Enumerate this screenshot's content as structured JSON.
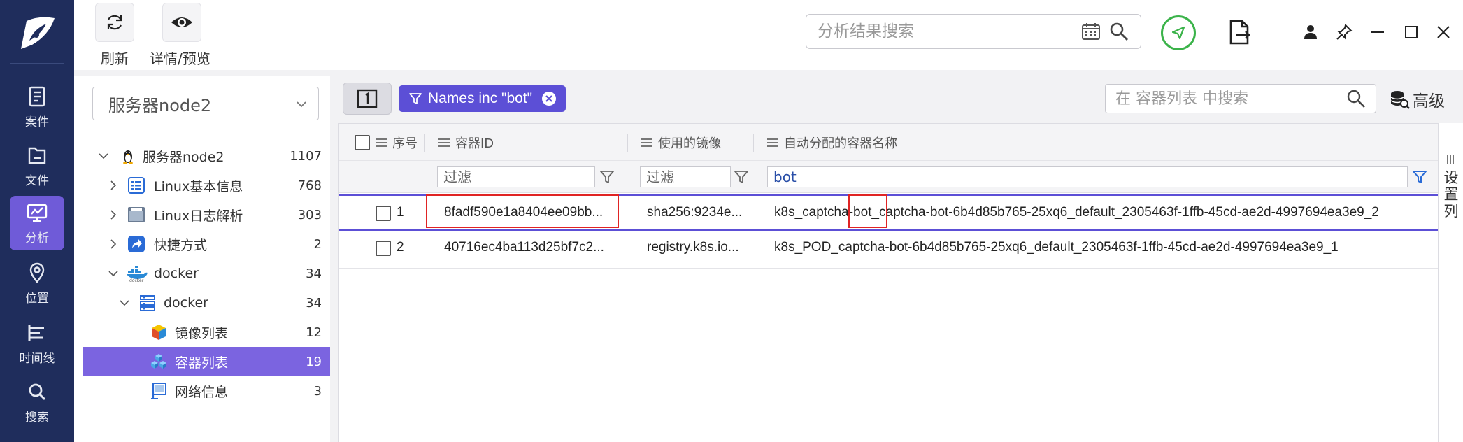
{
  "nav": {
    "items": [
      {
        "label": "案件",
        "icon": "case-icon"
      },
      {
        "label": "文件",
        "icon": "file-icon"
      },
      {
        "label": "分析",
        "icon": "analysis-icon",
        "active": true
      },
      {
        "label": "位置",
        "icon": "location-icon"
      },
      {
        "label": "时间线",
        "icon": "timeline-icon"
      },
      {
        "label": "搜索",
        "icon": "search-icon"
      }
    ]
  },
  "toolbar": {
    "refresh_label": "刷新",
    "details_label": "详情/预览",
    "search_placeholder": "分析结果搜索"
  },
  "tree": {
    "selector_value": "服务器node2",
    "rows": [
      {
        "label": "服务器node2",
        "count": "1107",
        "icon": "linux-penguin-icon",
        "expanded": true
      },
      {
        "label": "Linux基本信息",
        "count": "768",
        "icon": "list-icon",
        "expanded": false
      },
      {
        "label": "Linux日志解析",
        "count": "303",
        "icon": "log-icon",
        "expanded": false
      },
      {
        "label": "快捷方式",
        "count": "2",
        "icon": "shortcut-icon",
        "expanded": false
      },
      {
        "label": "docker",
        "count": "34",
        "icon": "docker-icon",
        "expanded": true
      },
      {
        "label": "docker",
        "count": "34",
        "icon": "server-icon",
        "expanded": true
      },
      {
        "label": "镜像列表",
        "count": "12",
        "icon": "image-cube-icon"
      },
      {
        "label": "容器列表",
        "count": "19",
        "icon": "containers-icon",
        "selected": true
      },
      {
        "label": "网络信息",
        "count": "3",
        "icon": "network-icon"
      }
    ]
  },
  "filterbar": {
    "chip_label": "Names inc \"bot\"",
    "search_placeholder": "在 容器列表 中搜索",
    "advanced_label": "高级"
  },
  "table": {
    "columns": [
      "序号",
      "容器ID",
      "使用的镜像",
      "自动分配的容器名称"
    ],
    "filters": {
      "id_placeholder": "过滤",
      "image_placeholder": "过滤",
      "name_value": "bot"
    },
    "rows": [
      {
        "index": "1",
        "id": "8fadf590e1a8404ee09bb...",
        "image": "sha256:9234e...",
        "name_prefix": "k8s_captcha",
        "name_match": "-bot_",
        "name_suffix": "captcha-bot-6b4d85b765-25xq6_default_2305463f-1ffb-45cd-ae2d-4997694ea3e9_2"
      },
      {
        "index": "2",
        "id": "40716ec4ba113d25bf7c2...",
        "image": "registry.k8s.io...",
        "name": "k8s_POD_captcha-bot-6b4d85b765-25xq6_default_2305463f-1ffb-45cd-ae2d-4997694ea3e9_1"
      }
    ]
  },
  "settings_strip": {
    "label": "设置列"
  },
  "colors": {
    "nav_bg": "#1f2d5c",
    "accent": "#6f5bd8",
    "chip": "#5c4fd6",
    "highlight_box": "#e02424",
    "send_green": "#3bb34a"
  }
}
